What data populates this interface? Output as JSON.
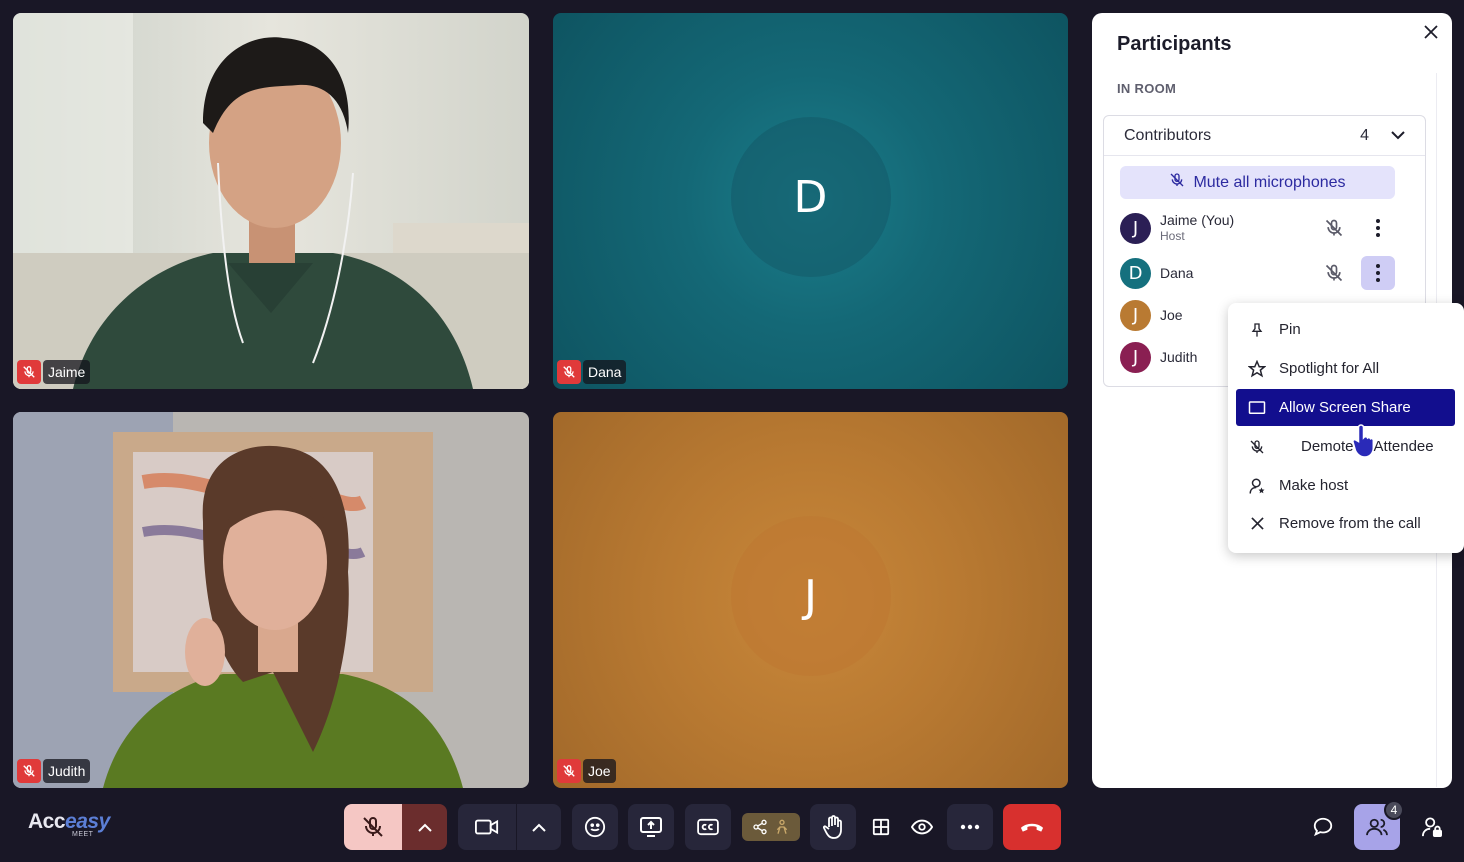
{
  "tiles": [
    {
      "name": "Jaime",
      "muted": true,
      "avatar_letter": "",
      "bg": "#3c5a46"
    },
    {
      "name": "Dana",
      "muted": true,
      "avatar_letter": "D",
      "bg": "#146876"
    },
    {
      "name": "Judith",
      "muted": true,
      "avatar_letter": "",
      "bg": "#5a6a4a"
    },
    {
      "name": "Joe",
      "muted": true,
      "avatar_letter": "J",
      "bg": "#b97a32"
    }
  ],
  "panel": {
    "title": "Participants",
    "section": "IN ROOM",
    "group": {
      "label": "Contributors",
      "count": "4"
    },
    "mute_all": "Mute all microphones",
    "participants": [
      {
        "letter": "J",
        "name": "Jaime (You)",
        "role": "Host",
        "color": "#2b1f55"
      },
      {
        "letter": "D",
        "name": "Dana",
        "role": "",
        "color": "#15707e"
      },
      {
        "letter": "J",
        "name": "Joe",
        "role": "",
        "color": "#b97a32"
      },
      {
        "letter": "J",
        "name": "Judith",
        "role": "",
        "color": "#8a1f52"
      }
    ]
  },
  "menu": {
    "items": [
      {
        "label": "Pin",
        "icon": "pin-icon"
      },
      {
        "label": "Spotlight for All",
        "icon": "star-icon"
      },
      {
        "label": "Allow Screen Share",
        "icon": "screen-icon",
        "highlighted": true
      },
      {
        "label": "Demote to Attendee",
        "icon": "mic-off-icon"
      },
      {
        "label": "Make host",
        "icon": "user-star-icon"
      },
      {
        "label": "Remove from the call",
        "icon": "close-icon"
      }
    ]
  },
  "toolbar": {
    "logo_a": "Acc",
    "logo_b": "easy",
    "logo_meet": "MEET",
    "participant_count": "4"
  },
  "colors": {
    "background": "#191726",
    "accent": "#120e8e",
    "end_call": "#d8302e",
    "mute_red": "#e03a3a"
  }
}
